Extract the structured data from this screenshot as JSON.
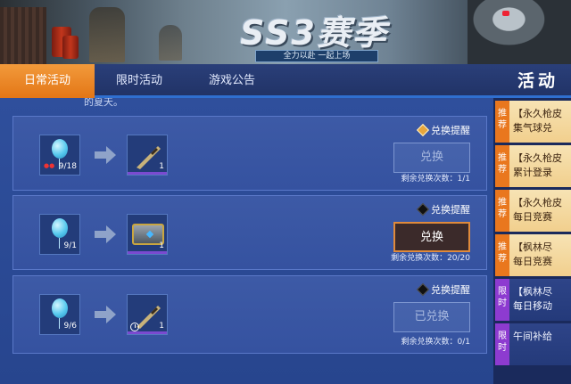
{
  "banner": {
    "season_title": "SS3赛季",
    "slogan": "全力以赴  一起上场"
  },
  "tabs": [
    {
      "label": "日常活动",
      "active": true
    },
    {
      "label": "限时活动",
      "active": false
    },
    {
      "label": "游戏公告",
      "active": false
    }
  ],
  "page_title": "活动",
  "partial_text": "的夏天。",
  "cards": [
    {
      "source_count": "9/18",
      "target_count": "1",
      "remind_label": "兑换提醒",
      "remind_on": true,
      "button_label": "兑换",
      "button_state": "disabled",
      "remain_text": "剩余兑换次数：1/1"
    },
    {
      "source_count": "9/1",
      "target_count": "1",
      "remind_label": "兑换提醒",
      "remind_on": false,
      "button_label": "兑换",
      "button_state": "active",
      "remain_text": "剩余兑换次数：20/20"
    },
    {
      "source_count": "9/6",
      "target_count": "1",
      "remind_label": "兑换提醒",
      "remind_on": false,
      "button_label": "已兑换",
      "button_state": "done",
      "remain_text": "剩余兑换次数：0/1"
    }
  ],
  "sidebar": [
    {
      "tag": "推荐",
      "line1": "【永久枪皮",
      "line2": "集气球兑"
    },
    {
      "tag": "推荐",
      "line1": "【永久枪皮",
      "line2": "累计登录"
    },
    {
      "tag": "推荐",
      "line1": "【永久枪皮",
      "line2": "每日竞赛"
    },
    {
      "tag": "推荐",
      "line1": "【枫林尽",
      "line2": "每日竞赛"
    },
    {
      "tag": "限时",
      "line1": "【枫林尽",
      "line2": "每日移动"
    },
    {
      "tag": "限时",
      "line1": "",
      "line2": "午间补给"
    }
  ],
  "colors": {
    "accent": "#e37616",
    "tab_underline": "#2f6fd0",
    "recommend_tag": "#e9771e",
    "limit_tag": "#8d3bd0"
  }
}
